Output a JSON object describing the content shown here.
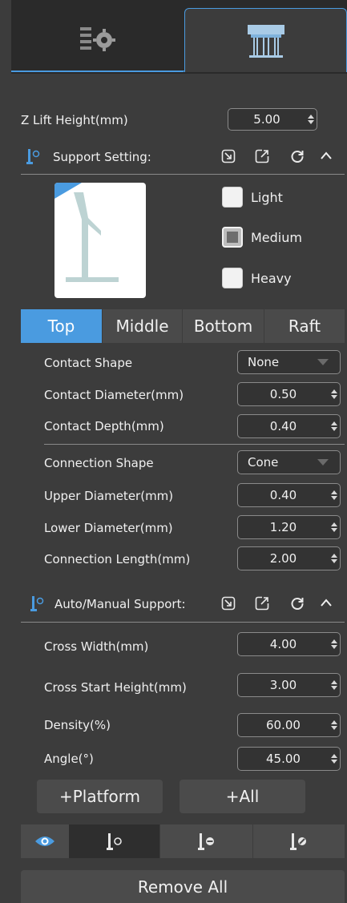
{
  "tabs": [
    {
      "name": "settings",
      "icon": "settings-gear-icon"
    },
    {
      "name": "support",
      "icon": "support-columns-icon",
      "active": true
    }
  ],
  "z_lift": {
    "label": "Z Lift Height(mm)",
    "value": "5.00"
  },
  "support_setting": {
    "title": "Support Setting:",
    "options": [
      {
        "label": "Light",
        "checked": false
      },
      {
        "label": "Medium",
        "checked": true
      },
      {
        "label": "Heavy",
        "checked": false
      }
    ]
  },
  "segments": [
    {
      "label": "Top",
      "active": true
    },
    {
      "label": "Middle",
      "active": false
    },
    {
      "label": "Bottom",
      "active": false
    },
    {
      "label": "Raft",
      "active": false
    }
  ],
  "top_params": {
    "contact_shape": {
      "label": "Contact Shape",
      "value": "None"
    },
    "contact_diameter": {
      "label": "Contact Diameter(mm)",
      "value": "0.50"
    },
    "contact_depth": {
      "label": "Contact Depth(mm)",
      "value": "0.40"
    },
    "connection_shape": {
      "label": "Connection Shape",
      "value": "Cone"
    },
    "upper_diameter": {
      "label": "Upper Diameter(mm)",
      "value": "0.40"
    },
    "lower_diameter": {
      "label": "Lower Diameter(mm)",
      "value": "1.20"
    },
    "connection_length": {
      "label": "Connection Length(mm)",
      "value": "2.00"
    }
  },
  "auto_manual": {
    "title": "Auto/Manual Support:",
    "cross_width": {
      "label": "Cross Width(mm)",
      "value": "4.00"
    },
    "cross_start_height": {
      "label": "Cross Start Height(mm)",
      "value": "3.00"
    },
    "density": {
      "label": "Density(%)",
      "value": "60.00"
    },
    "angle": {
      "label": "Angle(°)",
      "value": "45.00"
    }
  },
  "buttons": {
    "platform": "+Platform",
    "all": "+All",
    "remove_all": "Remove All"
  },
  "colors": {
    "accent": "#4a9be0",
    "panel": "#3c3c3c",
    "preview_model": "#bdd3d3"
  }
}
